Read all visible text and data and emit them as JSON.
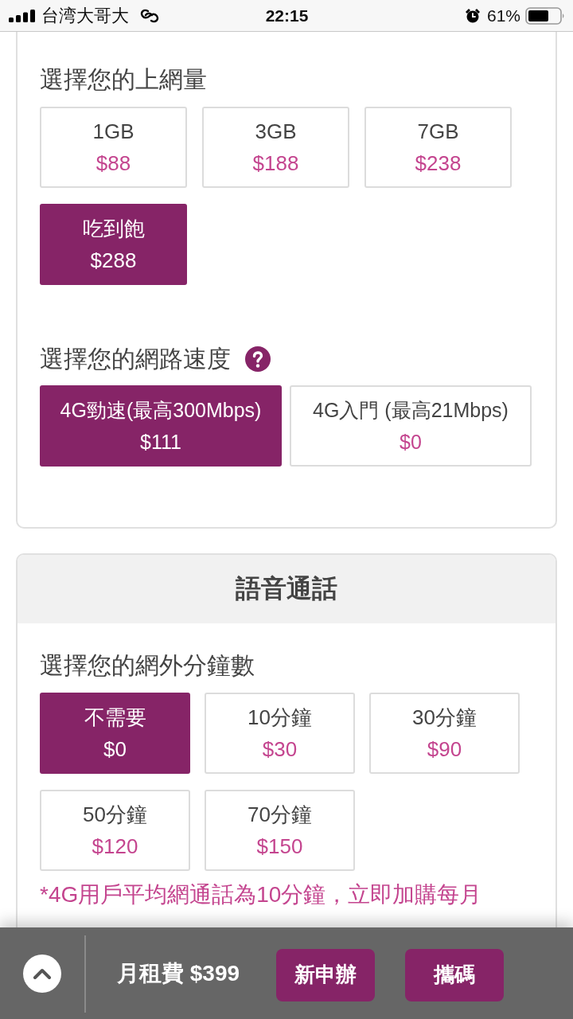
{
  "status_bar": {
    "carrier": "台湾大哥大",
    "time": "22:15",
    "battery_text": "61%"
  },
  "data_section": {
    "heading": "選擇您的上網量",
    "options": [
      {
        "label": "1GB",
        "price": "$88",
        "selected": false
      },
      {
        "label": "3GB",
        "price": "$188",
        "selected": false
      },
      {
        "label": "7GB",
        "price": "$238",
        "selected": false
      },
      {
        "label": "吃到飽",
        "price": "$288",
        "selected": true
      }
    ]
  },
  "speed_section": {
    "heading": "選擇您的網路速度",
    "options": [
      {
        "label": "4G勁速(最高300Mbps)",
        "price": "$111",
        "selected": true
      },
      {
        "label": "4G入門 (最高21Mbps)",
        "price": "$0",
        "selected": false
      }
    ]
  },
  "voice_card": {
    "title": "語音通話",
    "heading": "選擇您的網外分鐘數",
    "options": [
      {
        "label": "不需要",
        "price": "$0",
        "selected": true
      },
      {
        "label": "10分鐘",
        "price": "$30",
        "selected": false
      },
      {
        "label": "30分鐘",
        "price": "$90",
        "selected": false
      },
      {
        "label": "50分鐘",
        "price": "$120",
        "selected": false
      },
      {
        "label": "70分鐘",
        "price": "$150",
        "selected": false
      }
    ],
    "note": "*4G用戶平均網通話為10分鐘，立即加購每月"
  },
  "bottom_bar": {
    "total_label": "月租費 $399",
    "buttons": [
      "新申辦",
      "攜碼"
    ]
  }
}
